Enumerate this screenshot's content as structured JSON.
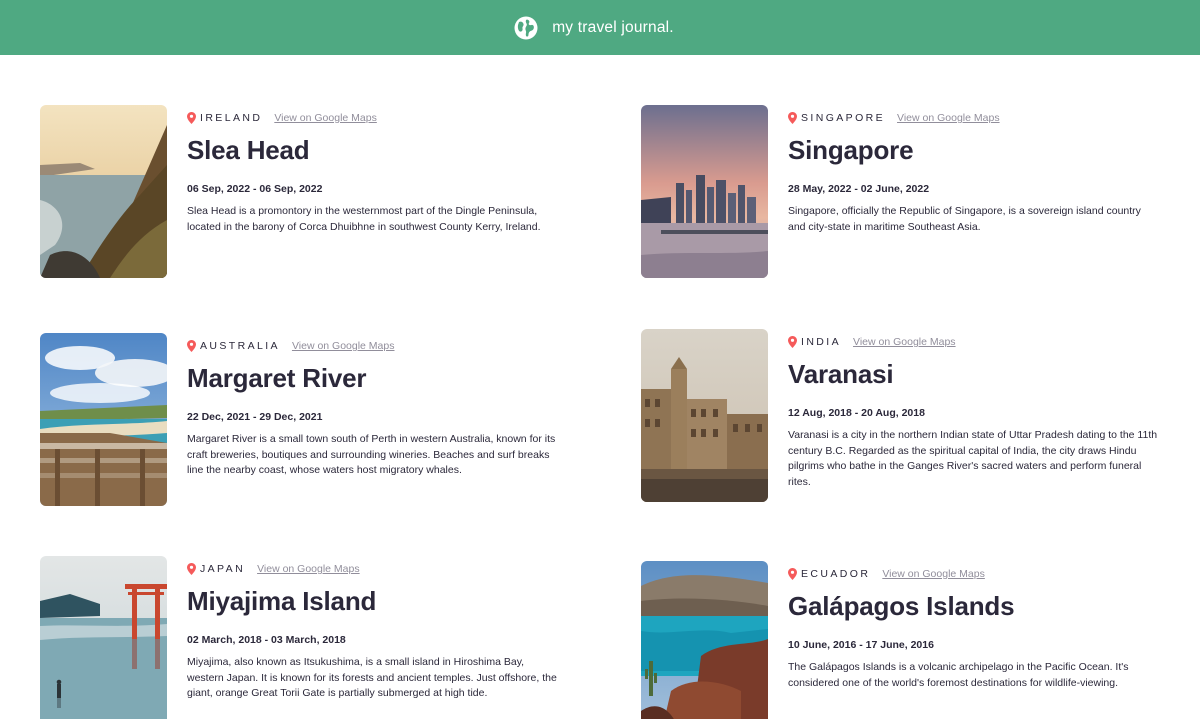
{
  "header": {
    "icon": "globe-icon",
    "title": "my travel journal."
  },
  "colors": {
    "header_bg": "#4fa982",
    "pin": "#f55a5a",
    "link": "#918e9b",
    "text": "#2b283a"
  },
  "entries": [
    {
      "country": "IRELAND",
      "link": "View on Google Maps",
      "title": "Slea Head",
      "dates": "06 Sep, 2022 - 06 Sep, 2022",
      "description": "Slea Head is a promontory in the westernmost part of the Dingle Peninsula, located in the barony of Corca Dhuibhne in southwest County Kerry, Ireland."
    },
    {
      "country": "SINGAPORE",
      "link": "View on Google Maps",
      "title": "Singapore",
      "dates": "28 May, 2022 - 02 June, 2022",
      "description": "Singapore, officially the Republic of Singapore, is a sovereign island country and city-state in maritime Southeast Asia."
    },
    {
      "country": "AUSTRALIA",
      "link": "View on Google Maps",
      "title": "Margaret River",
      "dates": "22 Dec, 2021 - 29 Dec, 2021",
      "description": "Margaret River is a small town south of Perth in western Australia, known for its craft breweries, boutiques and surrounding wineries. Beaches and surf breaks line the nearby coast, whose waters host migratory whales."
    },
    {
      "country": "INDIA",
      "link": "View on Google Maps",
      "title": "Varanasi",
      "dates": "12 Aug, 2018 - 20 Aug, 2018",
      "description": "Varanasi is a city in the northern Indian state of Uttar Pradesh dating to the 11th century B.C. Regarded as the spiritual capital of India, the city draws Hindu pilgrims who bathe in the Ganges River's sacred waters and perform funeral rites."
    },
    {
      "country": "JAPAN",
      "link": "View on Google Maps",
      "title": "Miyajima Island",
      "dates": "02 March, 2018 - 03 March, 2018",
      "description": "Miyajima, also known as Itsukushima, is a small island in Hiroshima Bay, western Japan. It is known for its forests and ancient temples. Just offshore, the giant, orange Great Torii Gate is partially submerged at high tide."
    },
    {
      "country": "ECUADOR",
      "link": "View on Google Maps",
      "title": "Galápagos Islands",
      "dates": "10 June, 2016 - 17 June, 2016",
      "description": "The Galápagos Islands is a volcanic archipelago in the Pacific Ocean. It's considered one of the world's foremost destinations for wildlife-viewing."
    }
  ]
}
